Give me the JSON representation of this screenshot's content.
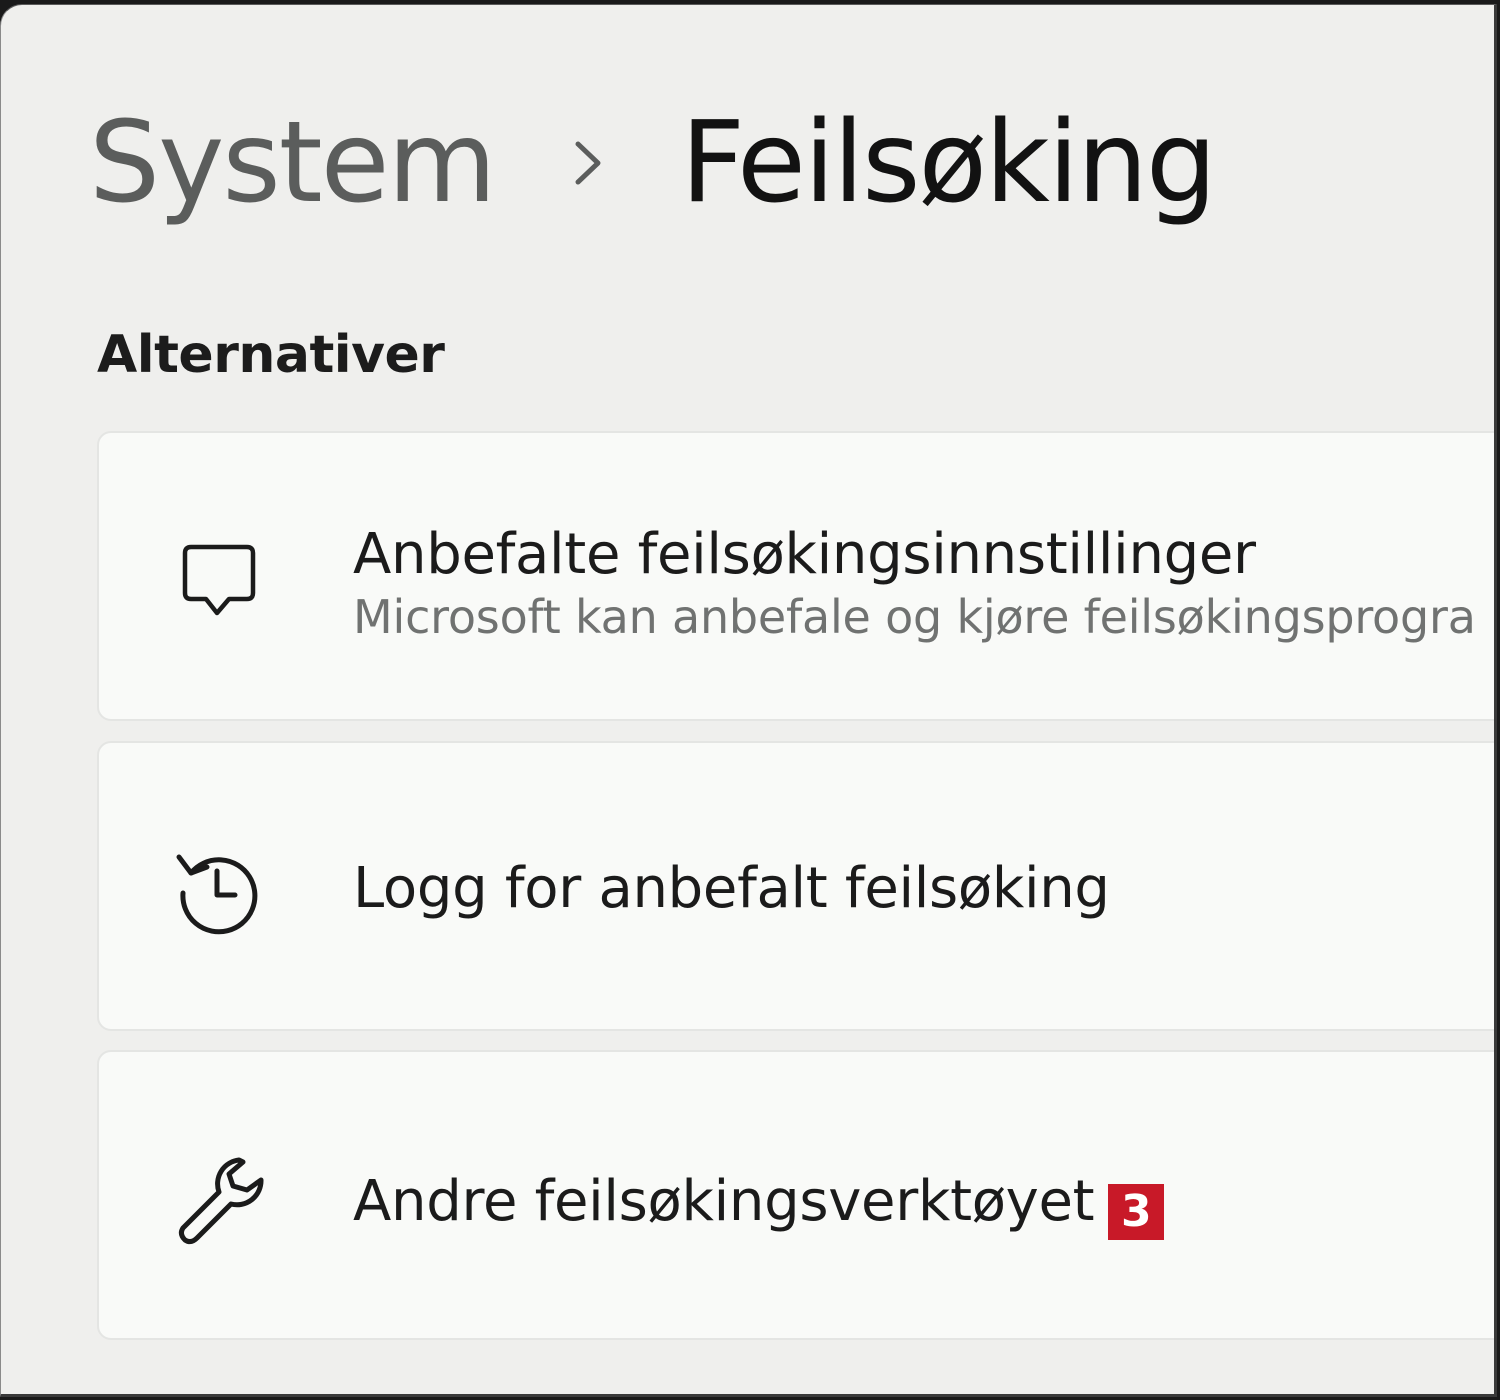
{
  "header": {
    "parent": "System",
    "current": "Feilsøking",
    "separator_icon": "chevron-right-icon"
  },
  "section": {
    "title": "Alternativer"
  },
  "cards": [
    {
      "icon": "chat-bubble-icon",
      "title": "Anbefalte feilsøkingsinnstillinger",
      "subtitle": "Microsoft kan anbefale og kjøre feilsøkingsprogra"
    },
    {
      "icon": "history-icon",
      "title": "Logg for anbefalt feilsøking"
    },
    {
      "icon": "wrench-icon",
      "title": "Andre feilsøkingsverktøyet",
      "badge": "3"
    }
  ],
  "colors": {
    "background": "#efefed",
    "card": "#f9faf8",
    "badge": "#c81928",
    "subtitle": "#707271"
  }
}
